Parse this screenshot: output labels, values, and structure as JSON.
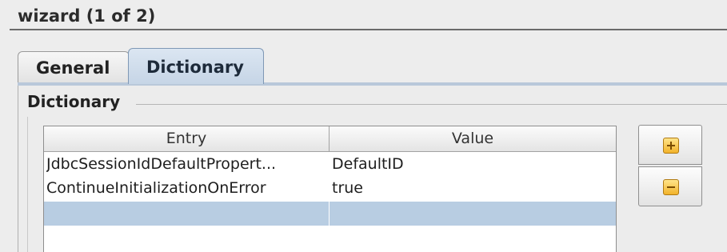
{
  "header": {
    "title": "wizard (1 of 2)"
  },
  "tabs": [
    {
      "label": "General",
      "active": false
    },
    {
      "label": "Dictionary",
      "active": true
    }
  ],
  "section": {
    "title": "Dictionary"
  },
  "table": {
    "columns": [
      "Entry",
      "Value"
    ],
    "rows": [
      {
        "entry": "JdbcSessionIdDefaultPropert...",
        "value": "DefaultID"
      },
      {
        "entry": "ContinueInitializationOnError",
        "value": "true"
      },
      {
        "entry": "",
        "value": "",
        "selected": true
      }
    ]
  },
  "buttons": {
    "add_icon": "plus-icon",
    "remove_icon": "minus-icon"
  },
  "colors": {
    "active_tab": "#c6d5e6",
    "selected_row": "#b8cde2",
    "button_icon": "#f2b32b"
  }
}
